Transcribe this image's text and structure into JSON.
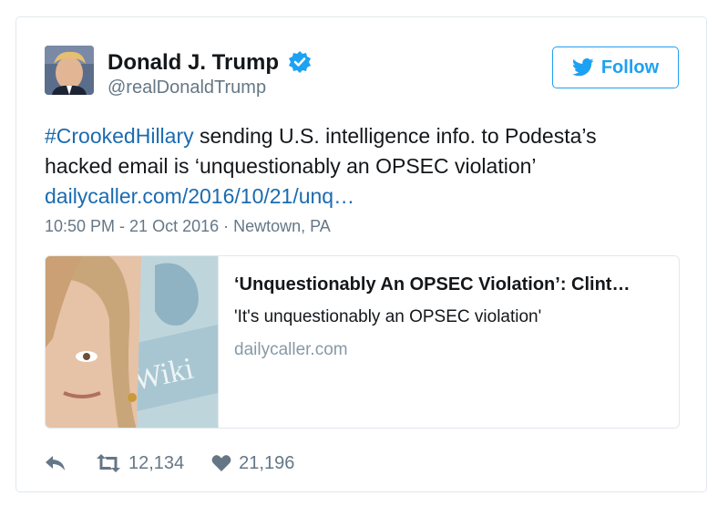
{
  "author": {
    "name": "Donald J. Trump",
    "handle": "@realDonaldTrump",
    "verified": true
  },
  "follow_button": {
    "label": "Follow",
    "icon": "twitter-bird-icon"
  },
  "tweet": {
    "hashtag": "#CrookedHillary",
    "line1_rest": " sending U.S. intelligence info. to Podesta’s",
    "line2": "hacked email is ‘unquestionably an OPSEC violation’",
    "link": "dailycaller.com/2016/10/21/unq…",
    "timestamp": "10:50 PM - 21 Oct 2016 · Newtown, PA"
  },
  "card": {
    "title": "‘Unquestionably An OPSEC Violation’: Clint…",
    "description": "'It's unquestionably an OPSEC violation'",
    "domain": "dailycaller.com",
    "image_text": "Wiki"
  },
  "actions": {
    "reply_icon": "reply-icon",
    "retweet_icon": "retweet-icon",
    "retweet_count": "12,134",
    "like_icon": "heart-icon",
    "like_count": "21,196"
  },
  "colors": {
    "accent": "#1da1f2",
    "link": "#1b6bb0",
    "muted": "#657786",
    "border": "#e1e8ed"
  }
}
